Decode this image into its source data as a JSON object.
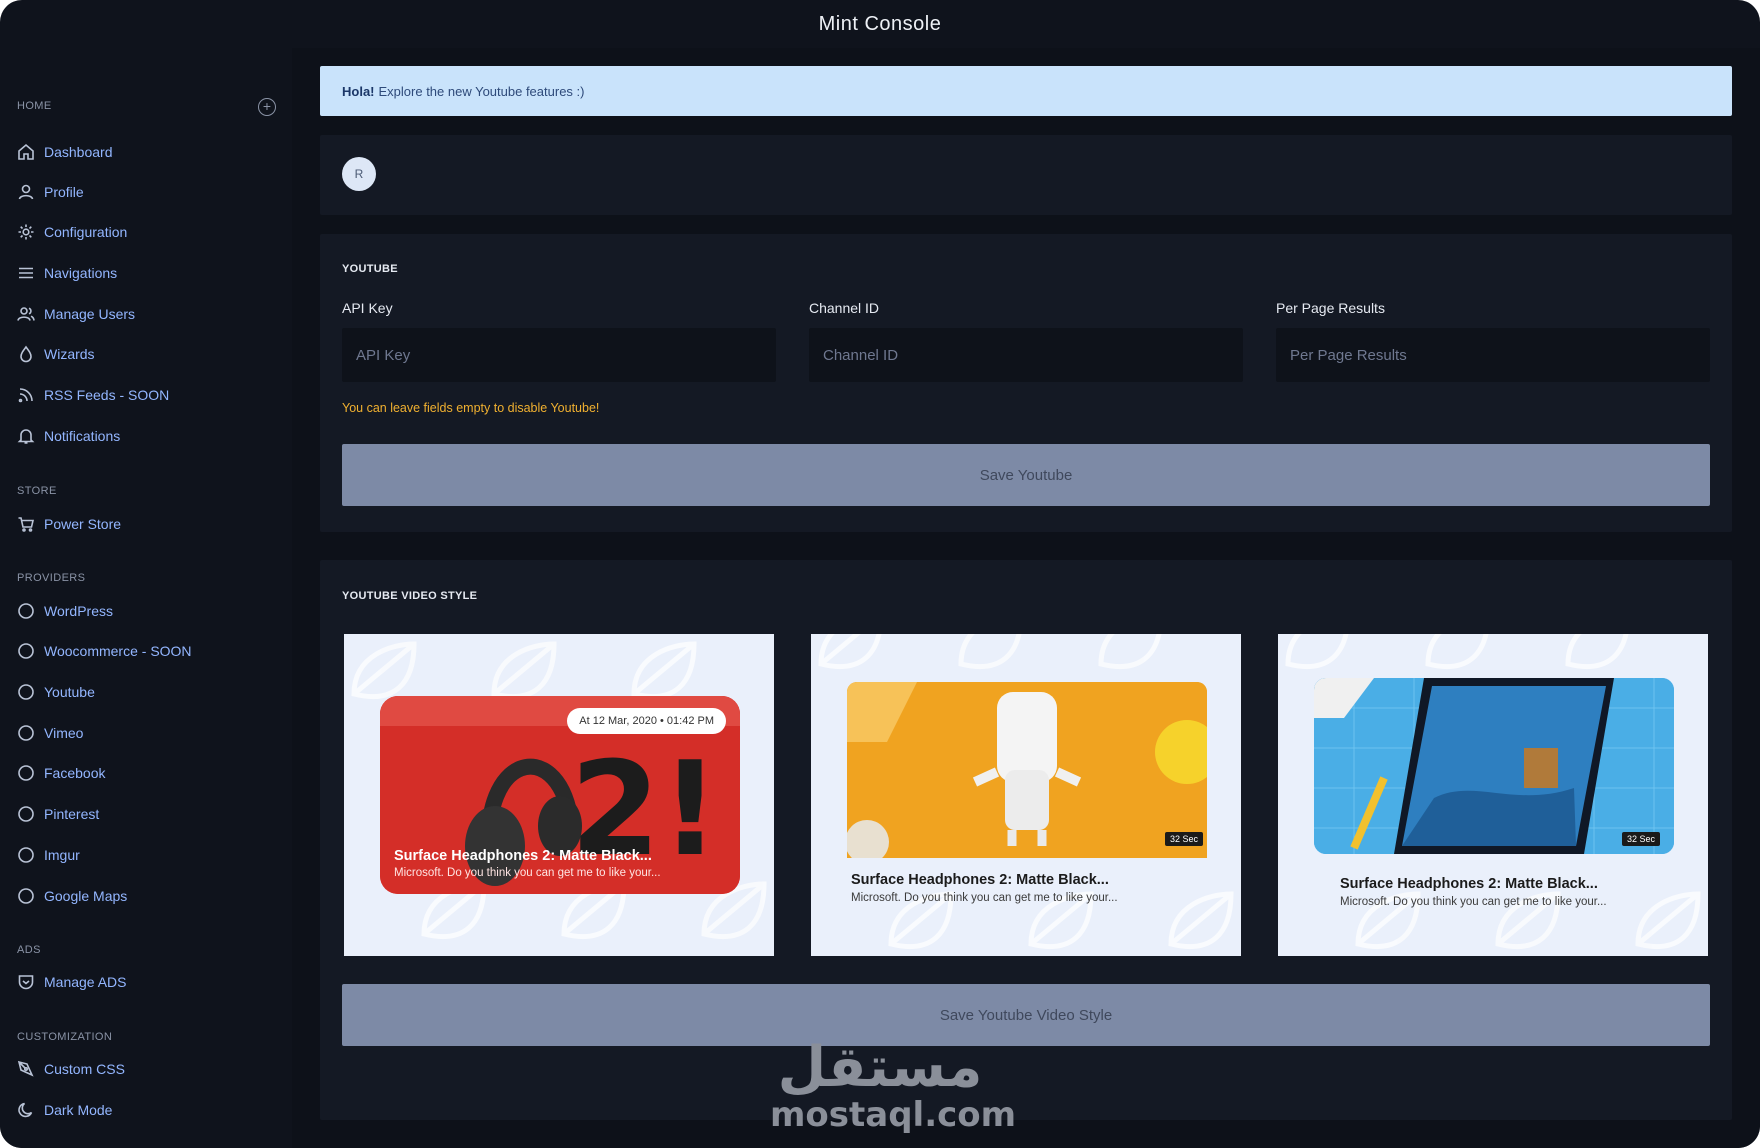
{
  "window": {
    "title": "Mint Console"
  },
  "sidebar": {
    "sections": [
      {
        "label": "HOME",
        "items": [
          {
            "label": "Dashboard",
            "icon": "home-icon"
          },
          {
            "label": "Profile",
            "icon": "user-icon"
          },
          {
            "label": "Configuration",
            "icon": "gear-icon"
          },
          {
            "label": "Navigations",
            "icon": "menu-icon"
          },
          {
            "label": "Manage Users",
            "icon": "users-icon"
          },
          {
            "label": "Wizards",
            "icon": "drop-icon"
          },
          {
            "label": "RSS Feeds - SOON",
            "icon": "rss-icon"
          },
          {
            "label": "Notifications",
            "icon": "bell-icon"
          }
        ]
      },
      {
        "label": "STORE",
        "items": [
          {
            "label": "Power Store",
            "icon": "cart-icon"
          }
        ]
      },
      {
        "label": "PROVIDERS",
        "items": [
          {
            "label": "WordPress",
            "icon": "circle-icon"
          },
          {
            "label": "Woocommerce - SOON",
            "icon": "circle-icon"
          },
          {
            "label": "Youtube",
            "icon": "circle-icon"
          },
          {
            "label": "Vimeo",
            "icon": "circle-icon"
          },
          {
            "label": "Facebook",
            "icon": "circle-icon"
          },
          {
            "label": "Pinterest",
            "icon": "circle-icon"
          },
          {
            "label": "Imgur",
            "icon": "circle-icon"
          },
          {
            "label": "Google Maps",
            "icon": "circle-icon"
          }
        ]
      },
      {
        "label": "ADS",
        "items": [
          {
            "label": "Manage ADS",
            "icon": "shield-icon"
          }
        ]
      },
      {
        "label": "CUSTOMIZATION",
        "items": [
          {
            "label": "Custom CSS",
            "icon": "brush-icon"
          },
          {
            "label": "Dark Mode",
            "icon": "moon-icon"
          }
        ]
      }
    ]
  },
  "alert": {
    "strong": "Hola!",
    "text": "Explore the new Youtube features :)"
  },
  "profile": {
    "avatar_initial": "R"
  },
  "youtube": {
    "title": "YOUTUBE",
    "fields": [
      {
        "label": "API Key",
        "placeholder": "API Key",
        "value": ""
      },
      {
        "label": "Channel ID",
        "placeholder": "Channel ID",
        "value": ""
      },
      {
        "label": "Per Page Results",
        "placeholder": "Per Page Results",
        "value": ""
      }
    ],
    "hint": "You can leave fields empty to disable Youtube!",
    "save_label": "Save Youtube"
  },
  "video_style": {
    "title": "YOUTUBE VIDEO STYLE",
    "cards": [
      {
        "title": "Surface Headphones 2: Matte Black...",
        "desc": "Microsoft. Do you think you can get me to like your...",
        "date": "At 12 Mar, 2020 • 01:42 PM"
      },
      {
        "title": "Surface Headphones 2: Matte Black...",
        "desc": "Microsoft. Do you think you can get me to like your...",
        "duration": "32 Sec"
      },
      {
        "title": "Surface Headphones 2: Matte Black...",
        "desc": "Microsoft. Do you think you can get me to like your...",
        "duration": "32 Sec"
      }
    ],
    "save_label": "Save Youtube Video Style"
  },
  "watermark": {
    "arabic": "مستقل",
    "latin": "mostaql.com"
  },
  "colors": {
    "background": "#0f131c",
    "accent": "#93b6ff",
    "alert_bg": "#c9e3fb",
    "hint": "#f0b030",
    "button": "#7d8aa6"
  }
}
